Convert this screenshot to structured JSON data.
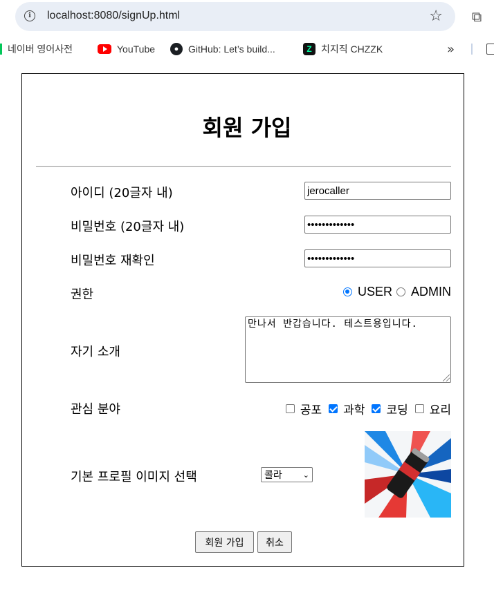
{
  "browser": {
    "url": "localhost:8080/signUp.html",
    "bookmarks": [
      {
        "label": "네이버 영어사전"
      },
      {
        "label": "YouTube"
      },
      {
        "label": "GitHub: Let’s build..."
      },
      {
        "label": "치지직 CHZZK"
      }
    ]
  },
  "form": {
    "title": "회원 가입",
    "id_label": "아이디 (20글자 내)",
    "id_value": "jerocaller",
    "pw_label": "비밀번호 (20글자 내)",
    "pw_value": "•••••••••••••",
    "pw_confirm_label": "비밀번호 재확인",
    "pw_confirm_value": "•••••••••••••",
    "role_label": "권한",
    "role_options": [
      "USER",
      "ADMIN"
    ],
    "role_selected": "USER",
    "intro_label": "자기 소개",
    "intro_value": "만나서 반갑습니다. 테스트용입니다.",
    "interest_label": "관심 분야",
    "interests": [
      {
        "label": "공포",
        "checked": false
      },
      {
        "label": "과학",
        "checked": true
      },
      {
        "label": "코딩",
        "checked": true
      },
      {
        "label": "요리",
        "checked": false
      }
    ],
    "profile_label": "기본 프로필 이미지 선택",
    "profile_select_value": "콜라",
    "submit_label": "회원 가입",
    "cancel_label": "취소"
  },
  "colors": {
    "accent": "#0075ff",
    "address_bar": "#e9eef6"
  }
}
